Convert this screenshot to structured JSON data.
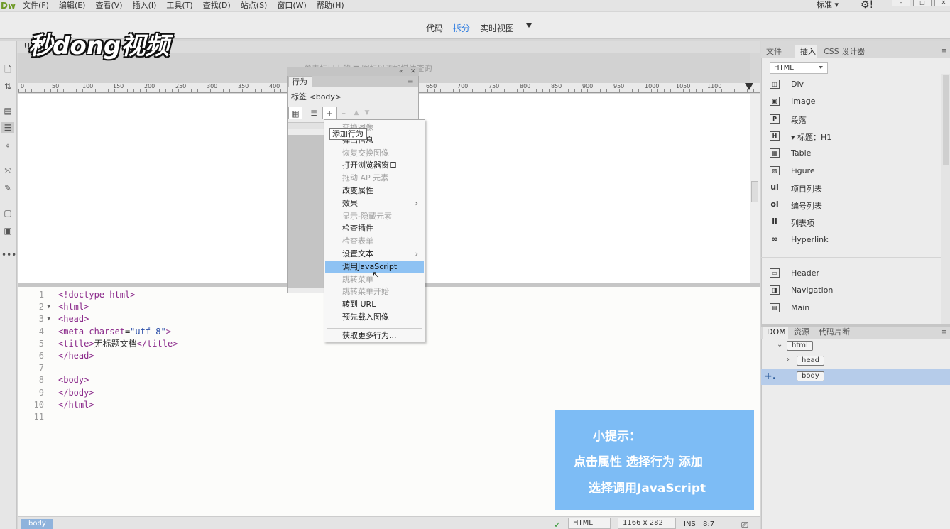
{
  "app": {
    "logo": "Dw"
  },
  "menubar": {
    "items": [
      "文件(F)",
      "编辑(E)",
      "查看(V)",
      "插入(I)",
      "工具(T)",
      "查找(D)",
      "站点(S)",
      "窗口(W)",
      "帮助(H)"
    ],
    "workspace": "标准 ▾",
    "gear": "⚙!"
  },
  "views": {
    "code": "代码",
    "split": "拆分",
    "live": "实时视图"
  },
  "document": {
    "tab": "Un",
    "mq_hint": "单击标尺上的 ▼ 图标以添加媒体查询"
  },
  "watermark": "秒dong视频",
  "ruler": [
    "0",
    "50",
    "100",
    "150",
    "200",
    "250",
    "300",
    "350",
    "400",
    "650",
    "700",
    "750",
    "800",
    "850",
    "900",
    "950",
    "1000",
    "1050",
    "1100"
  ],
  "code_lines": [
    {
      "n": "1",
      "fold": "",
      "parts": [
        [
          "tag",
          "<!doctype html>"
        ]
      ]
    },
    {
      "n": "2",
      "fold": "▼",
      "parts": [
        [
          "tag",
          "<html>"
        ]
      ]
    },
    {
      "n": "3",
      "fold": "▼",
      "parts": [
        [
          "tag",
          "<head>"
        ]
      ]
    },
    {
      "n": "4",
      "fold": "",
      "parts": [
        [
          "tag",
          "<meta "
        ],
        [
          "attr",
          "charset"
        ],
        [
          "plain",
          "="
        ],
        [
          "str",
          "\"utf-8\""
        ],
        [
          "tag",
          ">"
        ]
      ]
    },
    {
      "n": "5",
      "fold": "",
      "parts": [
        [
          "tag",
          "<title>"
        ],
        [
          "plain",
          "无标题文档"
        ],
        [
          "tag",
          "</title>"
        ]
      ]
    },
    {
      "n": "6",
      "fold": "",
      "parts": [
        [
          "tag",
          "</head>"
        ]
      ]
    },
    {
      "n": "7",
      "fold": "",
      "parts": []
    },
    {
      "n": "8",
      "fold": "",
      "parts": [
        [
          "tag",
          "<body>"
        ]
      ]
    },
    {
      "n": "9",
      "fold": "",
      "parts": [
        [
          "tag",
          "</body>"
        ]
      ]
    },
    {
      "n": "10",
      "fold": "",
      "parts": [
        [
          "tag",
          "</html>"
        ]
      ]
    },
    {
      "n": "11",
      "fold": "",
      "parts": []
    }
  ],
  "tip": {
    "title": "小提示：",
    "line1": "点击属性 选择行为 添加",
    "line2": "选择调用JavaScript"
  },
  "status": {
    "tag": "body",
    "mode": "HTML",
    "size": "1166 x 282",
    "ins": "INS",
    "pos": "8:7"
  },
  "behaviors": {
    "tab": "行为",
    "tag": "标签 <body>",
    "tooltip": "添加行为",
    "menu": [
      {
        "label": "交换图像",
        "disabled": true,
        "sub": false
      },
      {
        "label": "弹出信息",
        "disabled": false,
        "sub": false
      },
      {
        "label": "恢复交换图像",
        "disabled": true,
        "sub": false
      },
      {
        "label": "打开浏览器窗口",
        "disabled": false,
        "sub": false
      },
      {
        "label": "拖动 AP 元素",
        "disabled": true,
        "sub": false
      },
      {
        "label": "改变属性",
        "disabled": false,
        "sub": false
      },
      {
        "label": "效果",
        "disabled": false,
        "sub": true
      },
      {
        "label": "显示-隐藏元素",
        "disabled": true,
        "sub": false
      },
      {
        "label": "检查插件",
        "disabled": false,
        "sub": false
      },
      {
        "label": "检查表单",
        "disabled": true,
        "sub": false
      },
      {
        "label": "设置文本",
        "disabled": false,
        "sub": true
      },
      {
        "label": "调用JavaScript",
        "disabled": false,
        "sub": false,
        "highlight": true
      },
      {
        "label": "跳转菜单",
        "disabled": true,
        "sub": false
      },
      {
        "label": "跳转菜单开始",
        "disabled": true,
        "sub": false
      },
      {
        "label": "转到 URL",
        "disabled": false,
        "sub": false
      },
      {
        "label": "预先载入图像",
        "disabled": false,
        "sub": false
      },
      {
        "label": "获取更多行为...",
        "disabled": false,
        "sub": false
      }
    ]
  },
  "panels": {
    "tabs": [
      "文件",
      "插入",
      "CSS 设计器"
    ],
    "insert_category": "HTML",
    "insert_items": [
      {
        "icon": "div-icon",
        "glyph": "◫",
        "label": "Div"
      },
      {
        "icon": "image-icon",
        "glyph": "▣",
        "label": "Image"
      },
      {
        "icon": "paragraph-icon",
        "glyph": "P",
        "label": "段落"
      },
      {
        "icon": "heading-icon",
        "glyph": "H",
        "label": "▾ 标题：H1"
      },
      {
        "icon": "table-icon",
        "glyph": "▦",
        "label": "Table"
      },
      {
        "icon": "figure-icon",
        "glyph": "▨",
        "label": "Figure"
      },
      {
        "icon": "ul-icon",
        "glyph": "ul",
        "label": "项目列表"
      },
      {
        "icon": "ol-icon",
        "glyph": "ol",
        "label": "编号列表"
      },
      {
        "icon": "li-icon",
        "glyph": "li",
        "label": "列表项"
      },
      {
        "icon": "hyperlink-icon",
        "glyph": "∞",
        "label": "Hyperlink"
      },
      {
        "icon": "header-icon",
        "glyph": "▭",
        "label": "Header"
      },
      {
        "icon": "navigation-icon",
        "glyph": "◨",
        "label": "Navigation"
      },
      {
        "icon": "main-icon",
        "glyph": "▤",
        "label": "Main"
      }
    ],
    "dom_tabs": [
      "DOM",
      "资源",
      "代码片断"
    ],
    "dom_nodes": [
      "html",
      "head",
      "body"
    ]
  }
}
